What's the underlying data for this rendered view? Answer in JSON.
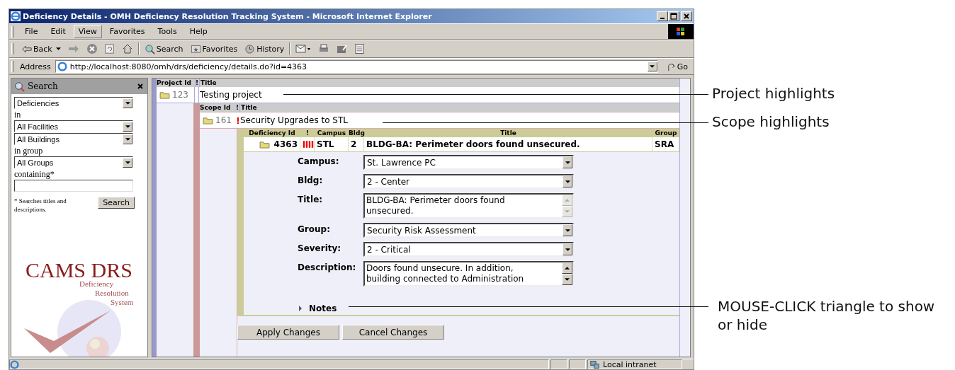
{
  "window": {
    "title": "Deficiency Details - OMH Deficiency Resolution Tracking System - Microsoft Internet Explorer"
  },
  "menu": [
    {
      "label": "File",
      "selected": false
    },
    {
      "label": "Edit",
      "selected": false
    },
    {
      "label": "View",
      "selected": true
    },
    {
      "label": "Favorites",
      "selected": false
    },
    {
      "label": "Tools",
      "selected": false
    },
    {
      "label": "Help",
      "selected": false
    }
  ],
  "toolbar": {
    "back": "Back",
    "search": "Search",
    "favorites": "Favorites",
    "history": "History"
  },
  "address": {
    "label": "Address",
    "url": "http://localhost:8080/omh/drs/deficiency/details.do?id=4363",
    "go": "Go"
  },
  "sidebar": {
    "title": "Search",
    "fields": [
      {
        "kind": "select",
        "value": "Deficiencies"
      },
      {
        "kind": "label",
        "text": "in"
      },
      {
        "kind": "select",
        "value": "All Facilities"
      },
      {
        "kind": "select",
        "value": "All Buildings"
      },
      {
        "kind": "label",
        "text": "in group"
      },
      {
        "kind": "select",
        "value": "All Groups"
      },
      {
        "kind": "label",
        "text": "containing*"
      },
      {
        "kind": "input"
      }
    ],
    "note": "* Searches titles and descriptions.",
    "button": "Search",
    "logo": {
      "title": "CAMS DRS",
      "lines": [
        "Deficiency",
        "Resolution",
        "System"
      ]
    }
  },
  "project": {
    "columns": [
      "Project Id",
      "!",
      "Title"
    ],
    "row": {
      "id": "123",
      "title": "Testing project"
    }
  },
  "scope": {
    "columns": [
      "Scope Id",
      "!",
      "Title"
    ],
    "row": {
      "id": "161",
      "flag": "!",
      "title": "Security Upgrades to STL"
    }
  },
  "deficiency": {
    "columns": [
      "Deficiency Id",
      "!",
      "Campus",
      "Bldg",
      "Title",
      "Group"
    ],
    "row": {
      "id": "4363",
      "campus": "STL",
      "bldg": "2",
      "title": "BLDG-BA: Perimeter doors found unsecured.",
      "group": "SRA"
    },
    "form": [
      {
        "label": "Campus:",
        "kind": "select",
        "value": "St. Lawrence PC"
      },
      {
        "label": "Bldg:",
        "kind": "select",
        "value": "2 - Center"
      },
      {
        "label": "Title:",
        "kind": "textarea",
        "value": "BLDG-BA: Perimeter doors found unsecured.",
        "disabled": true
      },
      {
        "label": "Group:",
        "kind": "select",
        "value": "Security Risk Assessment"
      },
      {
        "label": "Severity:",
        "kind": "select",
        "value": "2 - Critical"
      },
      {
        "label": "Description:",
        "kind": "textarea",
        "value": "Doors found unsecure. In addition, building connected to Administration",
        "disabled": false
      }
    ],
    "notes": {
      "label": "Notes",
      "expanded": false
    }
  },
  "buttons": [
    "Apply Changes",
    "Cancel Changes"
  ],
  "status_bar": {
    "zone": "Local intranet"
  },
  "annotations": [
    {
      "text": "Project highlights"
    },
    {
      "text": "Scope highlights"
    },
    {
      "text": "MOUSE-CLICK triangle to show or hide"
    }
  ]
}
